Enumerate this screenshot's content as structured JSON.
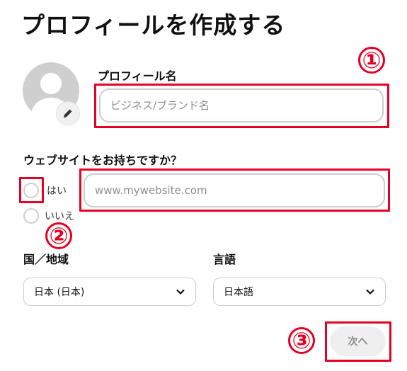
{
  "page": {
    "title": "プロフィールを作成する"
  },
  "profile": {
    "name_label": "プロフィール名",
    "name_placeholder": "ビジネス/ブランド名",
    "avatar_icon": "person-silhouette-icon",
    "edit_icon": "pencil-icon"
  },
  "website": {
    "question": "ウェブサイトをお持ちですか？",
    "yes_label": "はい",
    "no_label": "いいえ",
    "url_placeholder": "www.mywebsite.com"
  },
  "region": {
    "label": "国／地域",
    "selected": "日本 (日本)"
  },
  "language": {
    "label": "言語",
    "selected": "日本語"
  },
  "next_button": {
    "label": "次へ"
  },
  "annotations": {
    "marker_1": "①",
    "marker_2": "②",
    "marker_3": "③"
  },
  "colors": {
    "annotation_red": "#e60023",
    "input_border": "#cdcdcd",
    "avatar_gray": "#cfcfcf"
  }
}
